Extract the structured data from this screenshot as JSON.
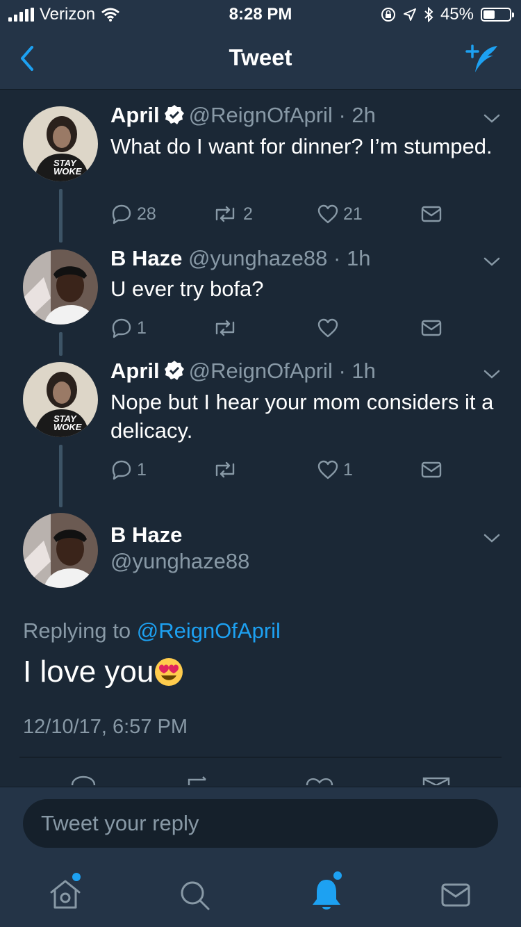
{
  "status": {
    "carrier": "Verizon",
    "time": "8:28 PM",
    "battery": "45%",
    "battery_level": 0.45
  },
  "nav": {
    "title": "Tweet"
  },
  "thread": [
    {
      "name": "April",
      "verified": true,
      "handle": "@ReignOfApril",
      "time": "2h",
      "text": "What do I want for dinner? I’m stumped.",
      "replies": "28",
      "retweets": "2",
      "likes": "21",
      "avatar_shirt_text": [
        "STAY",
        "WOKE"
      ]
    },
    {
      "name": "B Haze",
      "verified": false,
      "handle": "@yunghaze88",
      "time": "1h",
      "text": "U ever try bofa?",
      "replies": "1",
      "retweets": "",
      "likes": ""
    },
    {
      "name": "April",
      "verified": true,
      "handle": "@ReignOfApril",
      "time": "1h",
      "text": "Nope but I hear your mom considers it a delicacy.",
      "replies": "1",
      "retweets": "",
      "likes": "1",
      "avatar_shirt_text": [
        "STAY",
        "WOKE"
      ]
    }
  ],
  "focus": {
    "name": "B Haze",
    "handle": "@yunghaze88",
    "replying_prefix": "Replying to",
    "replying_to": "@ReignOfApril",
    "text": "I love you",
    "emoji": "😍",
    "timestamp": "12/10/17, 6:57 PM"
  },
  "reply_bar": {
    "placeholder": "Tweet your reply"
  },
  "tabs": [
    "home-icon",
    "search-icon",
    "notifications-icon",
    "messages-icon"
  ],
  "colors": {
    "accent": "#1da1f2",
    "background": "#1b2836",
    "bar": "#243447",
    "secondary_text": "#8899a6"
  }
}
